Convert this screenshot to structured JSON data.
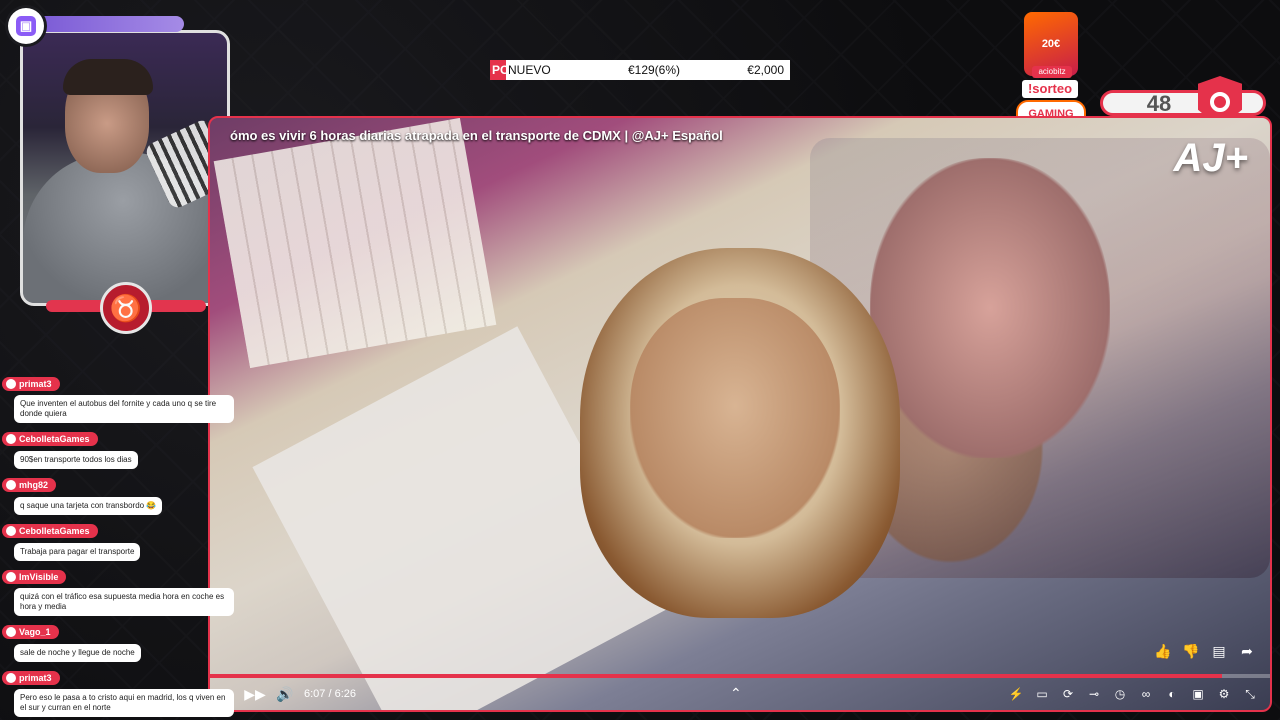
{
  "overlay": {
    "brand_colors": {
      "accent": "#e5324b",
      "purple": "#8b5cf6"
    },
    "sorteo_label": "!sorteo",
    "gaming_label": "GAMING",
    "counter_value": "48",
    "ig_price": "20€",
    "ig_label": "aciobitz"
  },
  "ticker": {
    "tag": "PC",
    "name": "NUEVO",
    "pct": "€129(6%)",
    "price": "€2,000"
  },
  "video": {
    "title": "ómo es vivir 6 horas diarias atrapada en el transporte de CDMX | @AJ+ Español",
    "logo": "AJ+",
    "time": "6:07 / 6:26",
    "progress": 0.955
  },
  "chat": [
    {
      "user": "primat3",
      "text": "Que inventen el autobus del fornite y cada uno q se tire donde quiera"
    },
    {
      "user": "CebolletaGames",
      "text": "90$en transporte todos los dias"
    },
    {
      "user": "mhg82",
      "text": "q saque una tarjeta con transbordo 😂"
    },
    {
      "user": "CebolletaGames",
      "text": "Trabaja para pagar el transporte"
    },
    {
      "user": "ImVisible",
      "text": "quizá con el tráfico esa supuesta media hora en coche es hora y media"
    },
    {
      "user": "Vago_1",
      "text": "sale de noche y llegue de noche"
    },
    {
      "user": "primat3",
      "text": "Pero eso le pasa a to cristo aqui en madrid, los q viven en el sur y curran en el norte"
    }
  ]
}
